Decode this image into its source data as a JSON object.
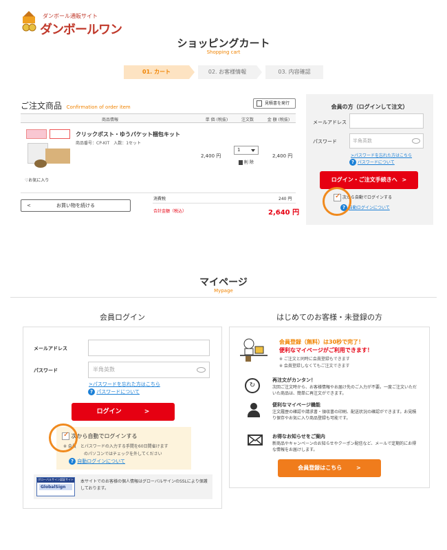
{
  "logo": {
    "tagline": "ダンボール通販サイト",
    "name": "ダンボールワン"
  },
  "cart": {
    "title": "ショッピングカート",
    "subtitle": "Shopping cart",
    "steps": [
      "01. カート",
      "02. お客様情報",
      "03. 内容確認"
    ],
    "section_title": "ご注文商品",
    "section_subtitle": "Confirmation of order item",
    "estimate_button": "見積書を発行",
    "headers": {
      "product": "商品情報",
      "unit_price": "単 価 (税抜)",
      "qty": "注文数",
      "amount": "金 額 (税抜)"
    },
    "item": {
      "name": "クリックポスト・ゆうパケット梱包キット",
      "code": "商品番号：CP-KIT　入数：1セット",
      "price": "2,400 円",
      "qty": "1",
      "delete": "削 除",
      "amount": "2,400 円",
      "favorite": "お気に入り"
    },
    "continue": "お買い物を続ける",
    "tax_label": "消費税",
    "tax_value": "240 円",
    "total_label": "合計金額（税込）",
    "total_value": "2,640 円"
  },
  "cart_login": {
    "title": "会員の方（ログインして注文）",
    "email_label": "メールアドレス",
    "password_label": "パスワード",
    "password_placeholder": "半角英数",
    "forgot": ">パスワードを忘れた方はこちら",
    "password_help": "パスワードについて",
    "button": "ログイン・ご注文手続きへ",
    "button_arrow": ">",
    "auto_login_prefix": "次",
    "auto_login": "から自動でログインする",
    "auto_help": "自動ログインについて"
  },
  "mypage": {
    "title": "マイページ",
    "subtitle": "Mypage"
  },
  "login": {
    "title": "会員ログイン",
    "email_label": "メールアドレス",
    "password_label": "パスワード",
    "password_placeholder": "半角英数",
    "forgot": ">パスワードを忘れた方はこちら",
    "password_help": "パスワードについて",
    "button": "ログイン",
    "button_arrow": ">",
    "auto_prefix": "次",
    "auto_login": "から自動でログインする",
    "note1": "※ 会員　とパスワードの入力する手間を60日間省けます",
    "note2": "のパソコンではチェックを外してください",
    "auto_help": "自動ログインについて",
    "globalsign_badge": "グローバルサイン認証サイト",
    "globalsign_brand": "GlobalSign",
    "ssl_text": "本サイトでのお客様の個人情報はグローバルサインのSSLにより保護しております。"
  },
  "register": {
    "title": "はじめてのお客様・未登録の方",
    "headline1": "会員登録（無料）は30秒で完了！",
    "headline2": "便利なマイページがご利用できます！",
    "bullet1": "※ ご注文と同時に会員登録もできます",
    "bullet2": "※ 会員登録しなくてもご注文できます",
    "features": [
      {
        "title": "再注文がカンタン！",
        "text": "次回ご注文時から、お客様情報やお届け先のご入力が不要。一度ご注文いただいた商品は、簡単に再注文ができます。"
      },
      {
        "title": "便利なマイページ機能",
        "text": "注文履歴の確認や請求書・領収書の印刷、配送状況の確認ができます。お見積り保存やお気に入り商品登録も可能です。"
      },
      {
        "title": "お得なお知らせをご案内",
        "text": "新商品やキャンペーンのお知らせやクーポン配信など、メールで定期的にお得な情報をお届けします。"
      }
    ],
    "button": "会員登録はこちら",
    "button_arrow": ">"
  },
  "colors": {
    "red": "#e60012",
    "orange": "#f08300",
    "blue": "#1a7fd6"
  }
}
